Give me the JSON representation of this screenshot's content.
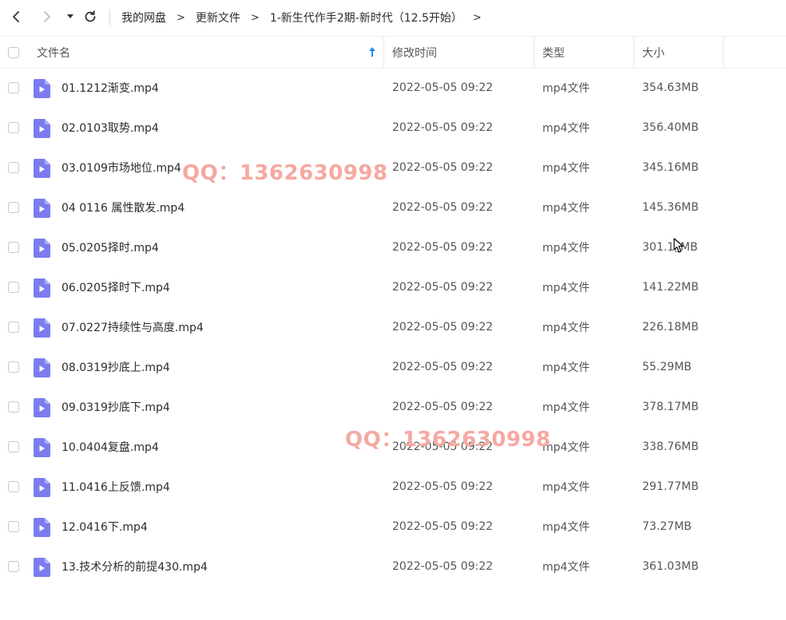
{
  "breadcrumb": {
    "items": [
      "我的网盘",
      "更新文件",
      "1-新生代作手2期-新时代（12.5开始）"
    ],
    "separator": ">"
  },
  "columns": {
    "name": "文件名",
    "modified": "修改时间",
    "type": "类型",
    "size": "大小"
  },
  "files": [
    {
      "name": "01.1212渐变.mp4",
      "modified": "2022-05-05 09:22",
      "type": "mp4文件",
      "size": "354.63MB"
    },
    {
      "name": "02.0103取势.mp4",
      "modified": "2022-05-05 09:22",
      "type": "mp4文件",
      "size": "356.40MB"
    },
    {
      "name": "03.0109市场地位.mp4",
      "modified": "2022-05-05 09:22",
      "type": "mp4文件",
      "size": "345.16MB"
    },
    {
      "name": "04 0116 属性散发.mp4",
      "modified": "2022-05-05 09:22",
      "type": "mp4文件",
      "size": "145.36MB"
    },
    {
      "name": "05.0205择时.mp4",
      "modified": "2022-05-05 09:22",
      "type": "mp4文件",
      "size": "301.1▯MB"
    },
    {
      "name": "06.0205择时下.mp4",
      "modified": "2022-05-05 09:22",
      "type": "mp4文件",
      "size": "141.22MB"
    },
    {
      "name": "07.0227持续性与高度.mp4",
      "modified": "2022-05-05 09:22",
      "type": "mp4文件",
      "size": "226.18MB"
    },
    {
      "name": "08.0319抄底上.mp4",
      "modified": "2022-05-05 09:22",
      "type": "mp4文件",
      "size": "55.29MB"
    },
    {
      "name": "09.0319抄底下.mp4",
      "modified": "2022-05-05 09:22",
      "type": "mp4文件",
      "size": "378.17MB"
    },
    {
      "name": "10.0404复盘.mp4",
      "modified": "2022-05-05 09:22",
      "type": "mp4文件",
      "size": "338.76MB"
    },
    {
      "name": "11.0416上反馈.mp4",
      "modified": "2022-05-05 09:22",
      "type": "mp4文件",
      "size": "291.77MB"
    },
    {
      "name": "12.0416下.mp4",
      "modified": "2022-05-05 09:22",
      "type": "mp4文件",
      "size": "73.27MB"
    },
    {
      "name": "13.技术分析的前提430.mp4",
      "modified": "2022-05-05 09:22",
      "type": "mp4文件",
      "size": "361.03MB"
    }
  ],
  "watermarks": [
    "QQ：1362630998",
    "QQ：1362630998"
  ],
  "icons": {
    "back": "chevron-left-icon",
    "forward": "chevron-right-icon",
    "history": "caret-down-icon",
    "refresh": "refresh-icon",
    "sort": "arrow-up-icon",
    "file": "video-file-icon"
  },
  "colors": {
    "accent": "#1a8cf0",
    "file_icon": "#7b7cf0",
    "watermark": "#f6a8a2"
  }
}
